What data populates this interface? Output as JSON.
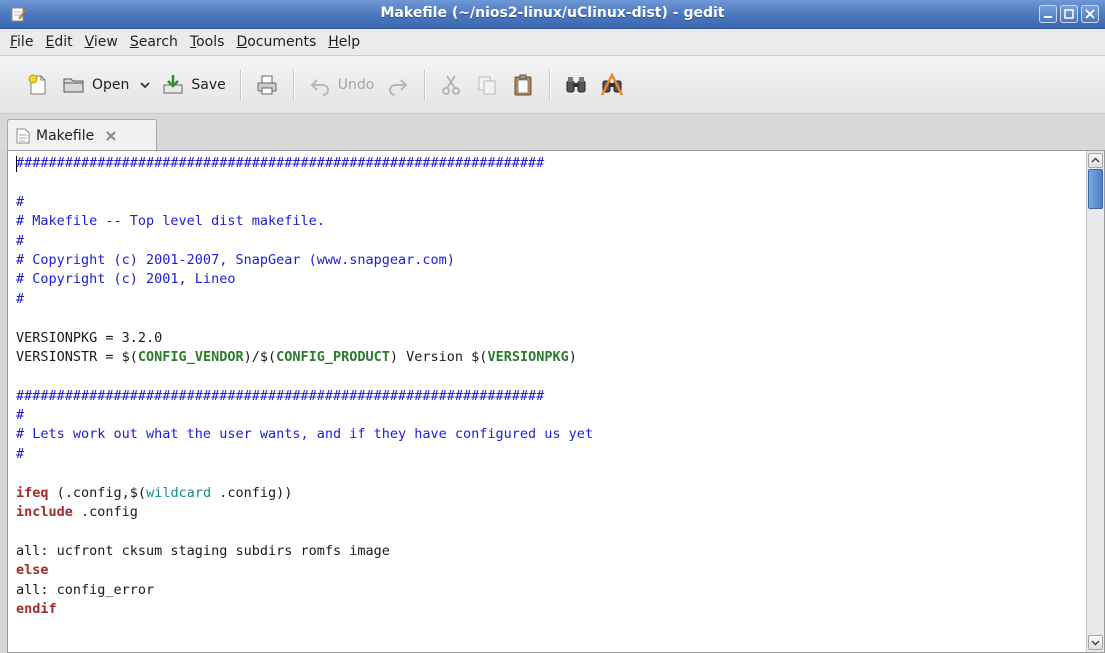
{
  "window": {
    "title": "Makefile (~/nios2-linux/uClinux-dist) - gedit"
  },
  "menubar": {
    "items": [
      {
        "ul": "F",
        "rest": "ile"
      },
      {
        "ul": "E",
        "rest": "dit"
      },
      {
        "ul": "V",
        "rest": "iew"
      },
      {
        "ul": "S",
        "rest": "earch"
      },
      {
        "ul": "T",
        "rest": "ools"
      },
      {
        "ul": "D",
        "rest": "ocuments"
      },
      {
        "ul": "H",
        "rest": "elp"
      }
    ]
  },
  "toolbar": {
    "open_label": "Open",
    "save_label": "Save",
    "undo_label": "Undo"
  },
  "tabs": [
    {
      "label": "Makefile"
    }
  ],
  "editor": {
    "lines": [
      [
        [
          "c",
          "#################################################################"
        ]
      ],
      [
        [
          "t",
          ""
        ]
      ],
      [
        [
          "c",
          "#"
        ]
      ],
      [
        [
          "c",
          "# Makefile -- Top level dist makefile."
        ]
      ],
      [
        [
          "c",
          "#"
        ]
      ],
      [
        [
          "c",
          "# Copyright (c) 2001-2007, SnapGear (www.snapgear.com)"
        ]
      ],
      [
        [
          "c",
          "# Copyright (c) 2001, Lineo"
        ]
      ],
      [
        [
          "c",
          "#"
        ]
      ],
      [
        [
          "t",
          ""
        ]
      ],
      [
        [
          "t",
          "VERSIONPKG = 3.2.0"
        ]
      ],
      [
        [
          "t",
          "VERSIONSTR = $("
        ],
        [
          "v",
          "CONFIG_VENDOR"
        ],
        [
          "t",
          ")/$("
        ],
        [
          "v",
          "CONFIG_PRODUCT"
        ],
        [
          "t",
          ") Version $("
        ],
        [
          "v",
          "VERSIONPKG"
        ],
        [
          "t",
          ")"
        ]
      ],
      [
        [
          "t",
          ""
        ]
      ],
      [
        [
          "c",
          "#################################################################"
        ]
      ],
      [
        [
          "c",
          "#"
        ]
      ],
      [
        [
          "c",
          "# Lets work out what the user wants, and if they have configured us yet"
        ]
      ],
      [
        [
          "c",
          "#"
        ]
      ],
      [
        [
          "t",
          ""
        ]
      ],
      [
        [
          "k",
          "ifeq"
        ],
        [
          "t",
          " (.config,$("
        ],
        [
          "f",
          "wildcard"
        ],
        [
          "t",
          " .config))"
        ]
      ],
      [
        [
          "k",
          "include"
        ],
        [
          "t",
          " .config"
        ]
      ],
      [
        [
          "t",
          ""
        ]
      ],
      [
        [
          "t",
          "all: ucfront cksum staging subdirs romfs image"
        ]
      ],
      [
        [
          "k",
          "else"
        ]
      ],
      [
        [
          "t",
          "all: config_error"
        ]
      ],
      [
        [
          "k",
          "endif"
        ]
      ]
    ]
  }
}
